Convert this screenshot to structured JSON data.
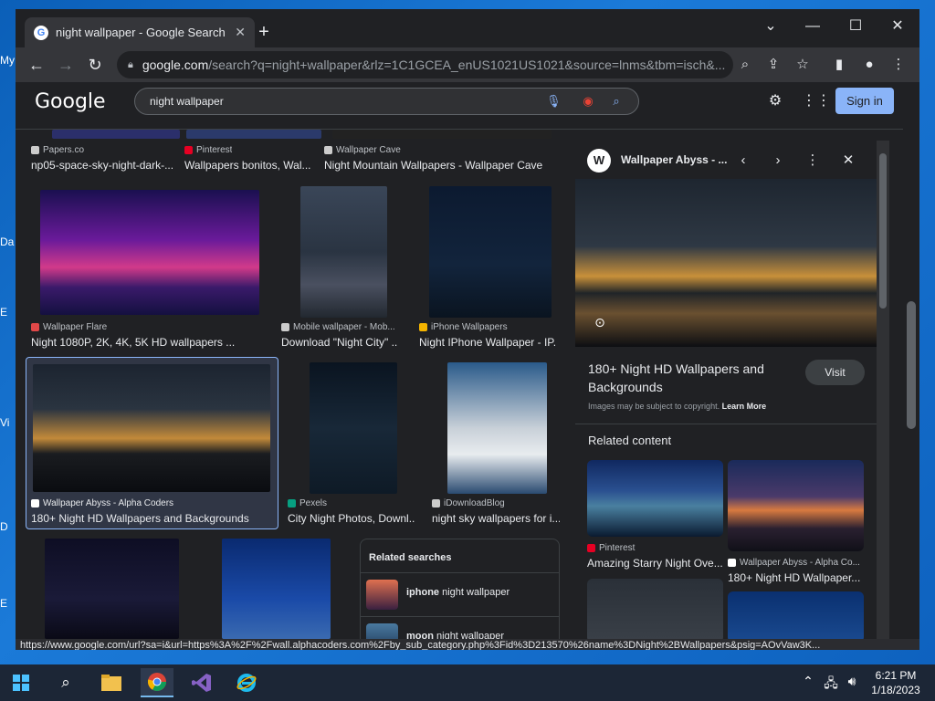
{
  "desktop": {
    "labels": [
      "My",
      "Da",
      "E",
      "Vi",
      "D",
      "E"
    ]
  },
  "browser": {
    "tab": {
      "title": "night wallpaper - Google Search",
      "favicon": "G"
    },
    "url": {
      "host": "google.com",
      "path": "/search?q=night+wallpaper&rlz=1C1GCEA_enUS1021US1021&source=lnms&tbm=isch&..."
    },
    "status_url": "https://www.google.com/url?sa=i&url=https%3A%2F%2Fwall.alphacoders.com%2Fby_sub_category.php%3Fid%3D213570%26name%3DNight%2BWallpapers&psig=AOvVaw3K..."
  },
  "google": {
    "logo": "Google",
    "query": "night wallpaper",
    "signin": "Sign in"
  },
  "results": {
    "row0": [
      {
        "source": "Papers.co",
        "caption": "np05-space-sky-night-dark-..."
      },
      {
        "source": "Pinterest",
        "caption": "Wallpapers bonitos, Wal..."
      },
      {
        "source": "Wallpaper Cave",
        "caption": "Night Mountain Wallpapers - Wallpaper Cave"
      }
    ],
    "row1": [
      {
        "source": "Wallpaper Flare",
        "caption": "Night 1080P, 2K, 4K, 5K HD wallpapers ..."
      },
      {
        "source": "Mobile wallpaper - Mob...",
        "caption": "Download \"Night City\" ..."
      },
      {
        "source": "iPhone Wallpapers",
        "caption": "Night IPhone Wallpaper - IP..."
      }
    ],
    "row2": [
      {
        "source": "Wallpaper Abyss - Alpha Coders",
        "caption": "180+ Night HD Wallpapers and Backgrounds"
      },
      {
        "source": "Pexels",
        "caption": "City Night Photos, Downl..."
      },
      {
        "source": "iDownloadBlog",
        "caption": "night sky wallpapers for i..."
      }
    ]
  },
  "related_searches": {
    "title": "Related searches",
    "items": [
      {
        "bold": "iphone",
        "rest": " night wallpaper"
      },
      {
        "bold": "moon",
        "rest": " night wallpaper"
      }
    ]
  },
  "panel": {
    "site": "Wallpaper Abyss - ...",
    "logo": "W",
    "title": "180+ Night HD Wallpapers and Backgrounds",
    "visit": "Visit",
    "copyright": "Images may be subject to copyright.",
    "learn_more": "Learn More",
    "related_title": "Related content",
    "related": [
      {
        "source": "Pinterest",
        "caption": "Amazing Starry Night Ove..."
      },
      {
        "source": "Wallpaper Abyss - Alpha Co...",
        "caption": "180+ Night HD Wallpaper..."
      }
    ]
  },
  "taskbar": {
    "time": "6:21 PM",
    "date": "1/18/2023"
  }
}
